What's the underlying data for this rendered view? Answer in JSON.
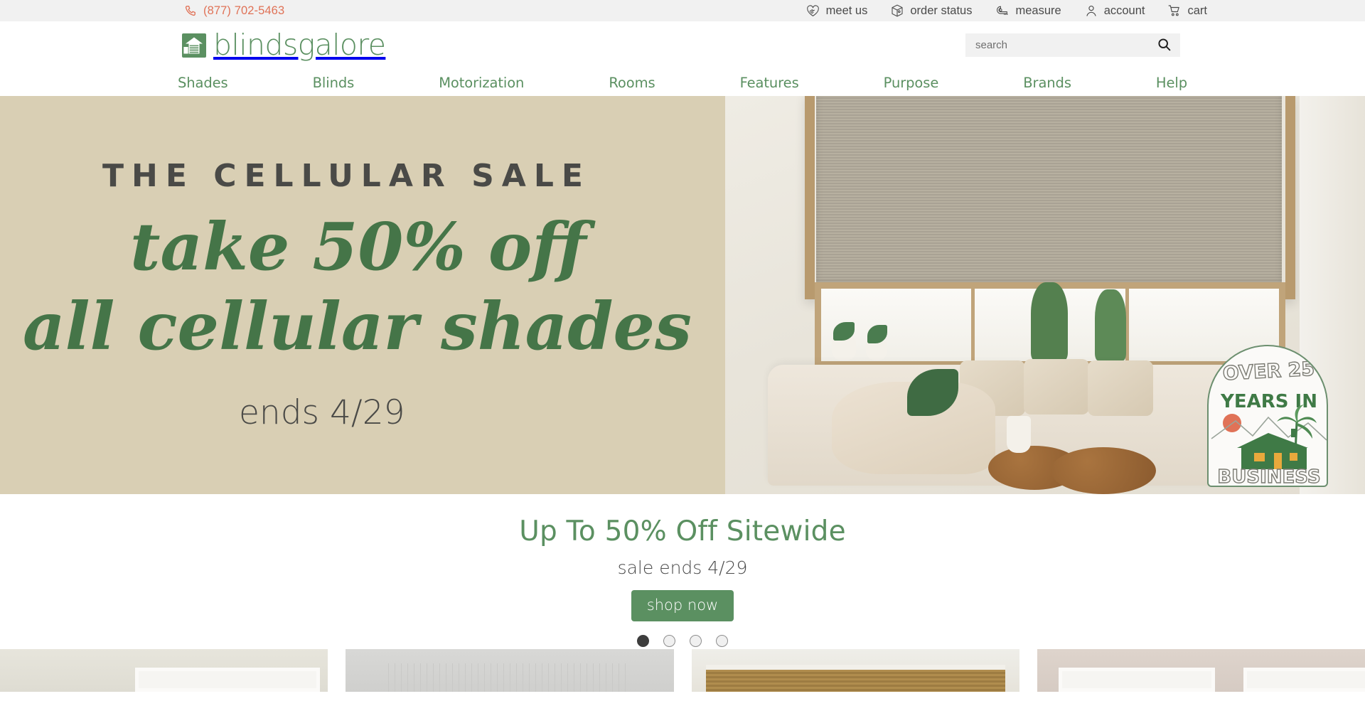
{
  "utility": {
    "phone": "(877) 702-5463",
    "phone_icon": "phone-icon",
    "links": [
      {
        "label": "meet us",
        "icon": "handshake-heart-icon"
      },
      {
        "label": "order status",
        "icon": "package-box-icon"
      },
      {
        "label": "measure",
        "icon": "tape-measure-icon"
      },
      {
        "label": "account",
        "icon": "user-icon"
      },
      {
        "label": "cart",
        "icon": "shopping-cart-icon"
      }
    ]
  },
  "brand": {
    "logo_text": "blindsgalore",
    "logo_icon": "house-with-blinds-icon"
  },
  "search": {
    "placeholder": "search",
    "value": "",
    "icon": "magnifier-icon"
  },
  "nav": {
    "items": [
      {
        "label": "Shades"
      },
      {
        "label": "Blinds"
      },
      {
        "label": "Motorization"
      },
      {
        "label": "Rooms"
      },
      {
        "label": "Features"
      },
      {
        "label": "Purpose"
      },
      {
        "label": "Brands"
      },
      {
        "label": "Help"
      }
    ]
  },
  "hero": {
    "kicker": "THE CELLULAR SALE",
    "headline_line1": "take 50% off",
    "headline_line2": "all cellular shades",
    "ends": "ends 4/29",
    "badge": {
      "line1": "OVER 25",
      "line2": "YEARS IN",
      "line3": "BUSINESS",
      "icon": "house-mountains-palm-sun-illustration"
    }
  },
  "promo": {
    "title": "Up To 50% Off Sitewide",
    "subtitle": "sale ends 4/29",
    "cta": "shop now",
    "slide_count": 4,
    "active_slide": 1
  },
  "tiles": [
    {
      "name": "product-tile-1"
    },
    {
      "name": "product-tile-2"
    },
    {
      "name": "product-tile-3"
    },
    {
      "name": "product-tile-4"
    }
  ],
  "colors": {
    "brand_green": "#5b9061",
    "hero_green": "#457548",
    "coral": "#e07257",
    "hero_bg": "#d9cfb4",
    "charcoal": "#4a4a47",
    "utility_bg": "#f1f1f1"
  }
}
